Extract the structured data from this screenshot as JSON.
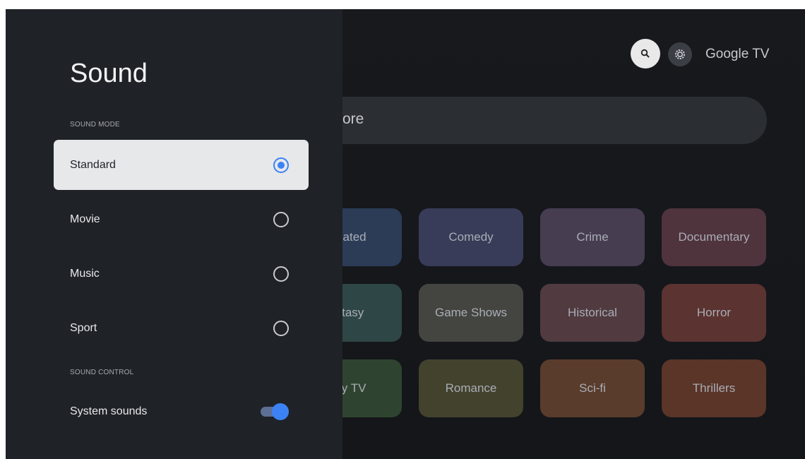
{
  "colors": {
    "accent": "#3c82f5",
    "panel_bg": "#1f2227",
    "selected_bg": "#e7e8ea"
  },
  "background": {
    "brand": "Google TV",
    "search_partial_text": "ore",
    "genres": [
      {
        "label": "mated",
        "color": "#2c3c57"
      },
      {
        "label": "Comedy",
        "color": "#393c58"
      },
      {
        "label": "Crime",
        "color": "#463d51"
      },
      {
        "label": "Documentary",
        "color": "#4f333d"
      },
      {
        "label": "ntasy",
        "color": "#2f4646"
      },
      {
        "label": "Game Shows",
        "color": "#444541"
      },
      {
        "label": "Historical",
        "color": "#513b40"
      },
      {
        "label": "Horror",
        "color": "#5b3331"
      },
      {
        "label": "lity TV",
        "color": "#2f4430"
      },
      {
        "label": "Romance",
        "color": "#43422d"
      },
      {
        "label": "Sci-fi",
        "color": "#5a3c2c"
      },
      {
        "label": "Thrillers",
        "color": "#5a3528"
      }
    ]
  },
  "panel": {
    "title": "Sound",
    "sound_mode_label": "SOUND MODE",
    "options": [
      {
        "label": "Standard",
        "selected": true
      },
      {
        "label": "Movie",
        "selected": false
      },
      {
        "label": "Music",
        "selected": false
      },
      {
        "label": "Sport",
        "selected": false
      }
    ],
    "sound_control_label": "SOUND CONTROL",
    "system_sounds_label": "System sounds",
    "system_sounds_on": true
  }
}
